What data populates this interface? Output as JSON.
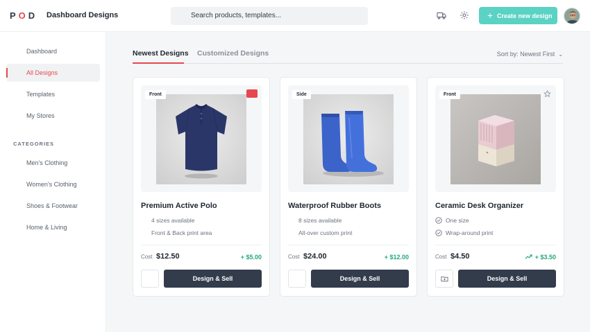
{
  "header": {
    "logo": "POD",
    "title": "Dashboard Designs",
    "search_placeholder": "Search products, templates...",
    "icons": [
      "truck-icon",
      "gear-icon"
    ],
    "create_label": "Create new design"
  },
  "sidebar": {
    "items": [
      {
        "label": "Dashboard",
        "active": false
      },
      {
        "label": "All Designs",
        "active": true
      },
      {
        "label": "Templates",
        "active": false
      },
      {
        "label": "My Stores",
        "active": false
      }
    ],
    "categories_heading": "CATEGORIES",
    "categories": [
      "Men's Clothing",
      "Women's Clothing",
      "Shoes & Footwear",
      "Home & Living"
    ]
  },
  "tabs": [
    {
      "label": "Newest Designs",
      "active": true
    },
    {
      "label": "Customized Designs",
      "active": false
    }
  ],
  "sort_label": "Sort by: Newest First",
  "products": [
    {
      "name": "Premium Active Polo",
      "view": "Front",
      "features": [
        "4 sizes available",
        "Front & Back print area"
      ],
      "cost_label": "Cost",
      "cost": "$12.50",
      "profit": "+ $5.00",
      "button": "Design & Sell"
    },
    {
      "name": "Waterproof Rubber Boots",
      "view": "Side",
      "features": [
        "8 sizes available",
        "All-over custom print"
      ],
      "cost_label": "Cost",
      "cost": "$24.00",
      "profit": "+ $12.00",
      "button": "Design & Sell"
    },
    {
      "name": "Ceramic Desk Organizer",
      "view": "Front",
      "features": [
        "One size",
        "Wrap-around print"
      ],
      "cost_label": "Cost",
      "cost": "$4.50",
      "profit": "+ $3.50",
      "button": "Design & Sell"
    }
  ],
  "colors": {
    "accent": "#e5484d",
    "brand": "#5ad2c4",
    "primary_button": "#323c4b",
    "profit": "#23a879"
  }
}
